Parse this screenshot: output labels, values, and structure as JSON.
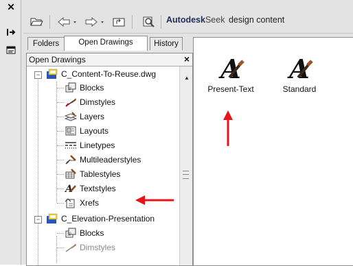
{
  "title_bar": {
    "close_glyph": "✕"
  },
  "toolbar": {
    "seek_brand": "Autodesk",
    "seek_word": "Seek",
    "seek_rest": "design content"
  },
  "tabs": [
    {
      "label": "Folders"
    },
    {
      "label": "Open Drawings"
    },
    {
      "label": "History"
    }
  ],
  "tree_panel": {
    "title": "Open Drawings",
    "close_glyph": "×"
  },
  "tree": {
    "drawing1": {
      "label": "C_Content-To-Reuse.dwg",
      "toggle": "−"
    },
    "items1": [
      {
        "label": "Blocks",
        "icon": "blocks-icon"
      },
      {
        "label": "Dimstyles",
        "icon": "dimstyles-icon"
      },
      {
        "label": "Layers",
        "icon": "layers-icon"
      },
      {
        "label": "Layouts",
        "icon": "layouts-icon"
      },
      {
        "label": "Linetypes",
        "icon": "linetypes-icon"
      },
      {
        "label": "Multileaderstyles",
        "icon": "multileaderstyles-icon"
      },
      {
        "label": "Tablestyles",
        "icon": "tablestyles-icon"
      },
      {
        "label": "Textstyles",
        "icon": "textstyles-icon"
      },
      {
        "label": "Xrefs",
        "icon": "xrefs-icon"
      }
    ],
    "drawing2": {
      "label": "C_Elevation-Presentation",
      "toggle": "−"
    },
    "items2": [
      {
        "label": "Blocks",
        "icon": "blocks-icon"
      },
      {
        "label": "Dimstyles",
        "icon": "dimstyles-icon"
      }
    ]
  },
  "content": {
    "items": [
      {
        "label": "Present-Text",
        "glyph": "A"
      },
      {
        "label": "Standard",
        "glyph": "A"
      }
    ]
  },
  "colors": {
    "annotation_arrow": "#e8141b",
    "drawing_icon_blue": "#2a55b8",
    "drawing_icon_yellow": "#f1d021"
  }
}
